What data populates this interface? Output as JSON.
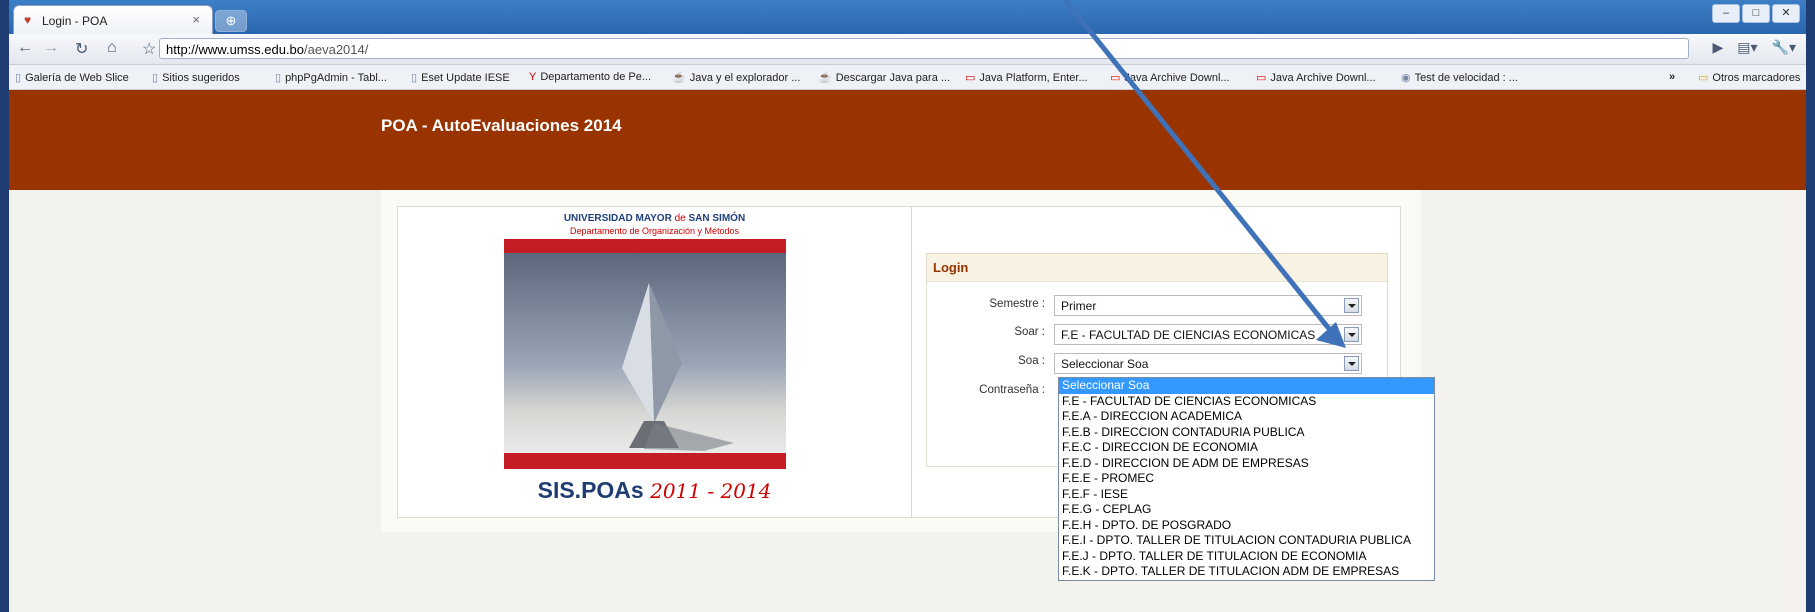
{
  "browser": {
    "tab_title": "Login - POA",
    "tab_close": "×",
    "url_domain": "http://www.umss.edu.bo",
    "url_path": "/aeva2014/",
    "bookmarks": [
      "Galería de Web Slice",
      "Sitios sugeridos",
      "phpPgAdmin - Tabl...",
      "Eset Update IESE",
      "Departamento de Pe...",
      "Java y el explorador ...",
      "Descargar Java para ...",
      "Java Platform, Enter...",
      "Java Archive Downl...",
      "Java Archive Downl...",
      "Test de velocidad : ..."
    ],
    "bookmarks_more": "»",
    "other_bookmarks": "Otros marcadores"
  },
  "page": {
    "header_title": "POA - AutoEvaluaciones 2014",
    "university_a": "UNIVERSIDAD MAYOR",
    "university_de": "de",
    "university_b": "SAN SIMÓN",
    "department": "Departamento de Organización y Métodos",
    "logo_main": "SIS.POAs",
    "logo_years": "2011 - 2014"
  },
  "login": {
    "heading": "Login",
    "semestre_label": "Semestre :",
    "semestre_value": "Primer",
    "soar_label": "Soar :",
    "soar_value": "F.E - FACULTAD DE CIENCIAS ECONOMICAS",
    "soa_label": "Soa :",
    "soa_value": "Seleccionar Soa",
    "password_label": "Contraseña :"
  },
  "soa_options": [
    "Seleccionar Soa",
    "F.E - FACULTAD DE CIENCIAS ECONOMICAS",
    "F.E.A - DIRECCION ACADEMICA",
    "F.E.B - DIRECCION CONTADURIA PUBLICA",
    "F.E.C - DIRECCION DE ECONOMIA",
    "F.E.D - DIRECCION DE ADM DE EMPRESAS",
    "F.E.E - PROMEC",
    "F.E.F - IESE",
    "F.E.G - CEPLAG",
    "F.E.H - DPTO. DE POSGRADO",
    "F.E.I - DPTO. TALLER DE TITULACION CONTADURIA PUBLICA",
    "F.E.J - DPTO. TALLER DE TITULACION DE ECONOMIA",
    "F.E.K - DPTO. TALLER DE TITULACION ADM DE EMPRESAS"
  ],
  "colors": {
    "header": "#993300",
    "accent_blue": "#3399ff",
    "frame": "#1f3d73"
  }
}
